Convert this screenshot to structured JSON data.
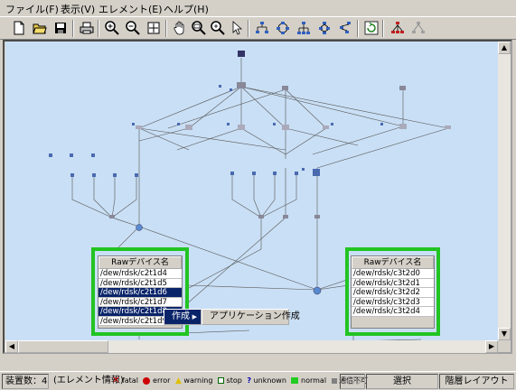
{
  "menu": {
    "items": [
      {
        "label": "ファイル(F)"
      },
      {
        "label": "表示(V)"
      },
      {
        "label": "エレメント(E)"
      },
      {
        "label": "ヘルプ(H)"
      }
    ]
  },
  "toolbar": {
    "buttons": [
      "new-icon",
      "open-icon",
      "save-icon",
      "print-icon",
      "zoom-in-icon",
      "zoom-out-icon",
      "fit-icon",
      "hand-icon",
      "zoom-rect-icon",
      "zoom-area-icon",
      "pointer-icon",
      "layout-tree-icon",
      "layout-circle-icon",
      "layout-hier-icon",
      "layout-org-icon",
      "layout-free-icon",
      "refresh-icon",
      "expand-icon",
      "collapse-icon"
    ]
  },
  "raw_list_left": {
    "header": "Rawデバイス名",
    "rows": [
      "/dew/rdsk/c2t1d4",
      "/dew/rdsk/c2t1d5",
      "/dew/rdsk/c2t1d6",
      "/dew/rdsk/c2t1d7",
      "/dew/rdsk/c2t1d8",
      "/dew/rdsk/c2t1d9"
    ],
    "selected": [
      "/dew/rdsk/c2t1d6",
      "/dew/rdsk/c2t1d8"
    ]
  },
  "raw_list_right": {
    "header": "Rawデバイス名",
    "rows": [
      "/dew/rdsk/c3t2d0",
      "/dew/rdsk/c3t2d1",
      "/dew/rdsk/c3t2d2",
      "/dew/rdsk/c3t2d3",
      "/dew/rdsk/c3t2d4"
    ]
  },
  "context_menu": {
    "item": "作成",
    "submenu_item": "アプリケーション作成"
  },
  "statusbar": {
    "device_count": "装置数：4",
    "element_info": "(エレメント情報)",
    "legend": [
      {
        "label": "fatal",
        "color": "#cc0000"
      },
      {
        "label": "error",
        "color": "#cc0000"
      },
      {
        "label": "warning",
        "color": "#e0c000"
      },
      {
        "label": "stop",
        "color": "#006600"
      },
      {
        "label": "unknown",
        "color": "#0000aa"
      },
      {
        "label": "normal",
        "color": "#22cc22"
      },
      {
        "label": "通信不可",
        "color": "#808080"
      }
    ],
    "mode_disabled": "矩形",
    "mode_select": "選択",
    "layout": "階層レイアウト"
  },
  "colors": {
    "canvas_bg": "#c9dff5",
    "group_border": "#22c422",
    "selection": "#0a246a"
  }
}
